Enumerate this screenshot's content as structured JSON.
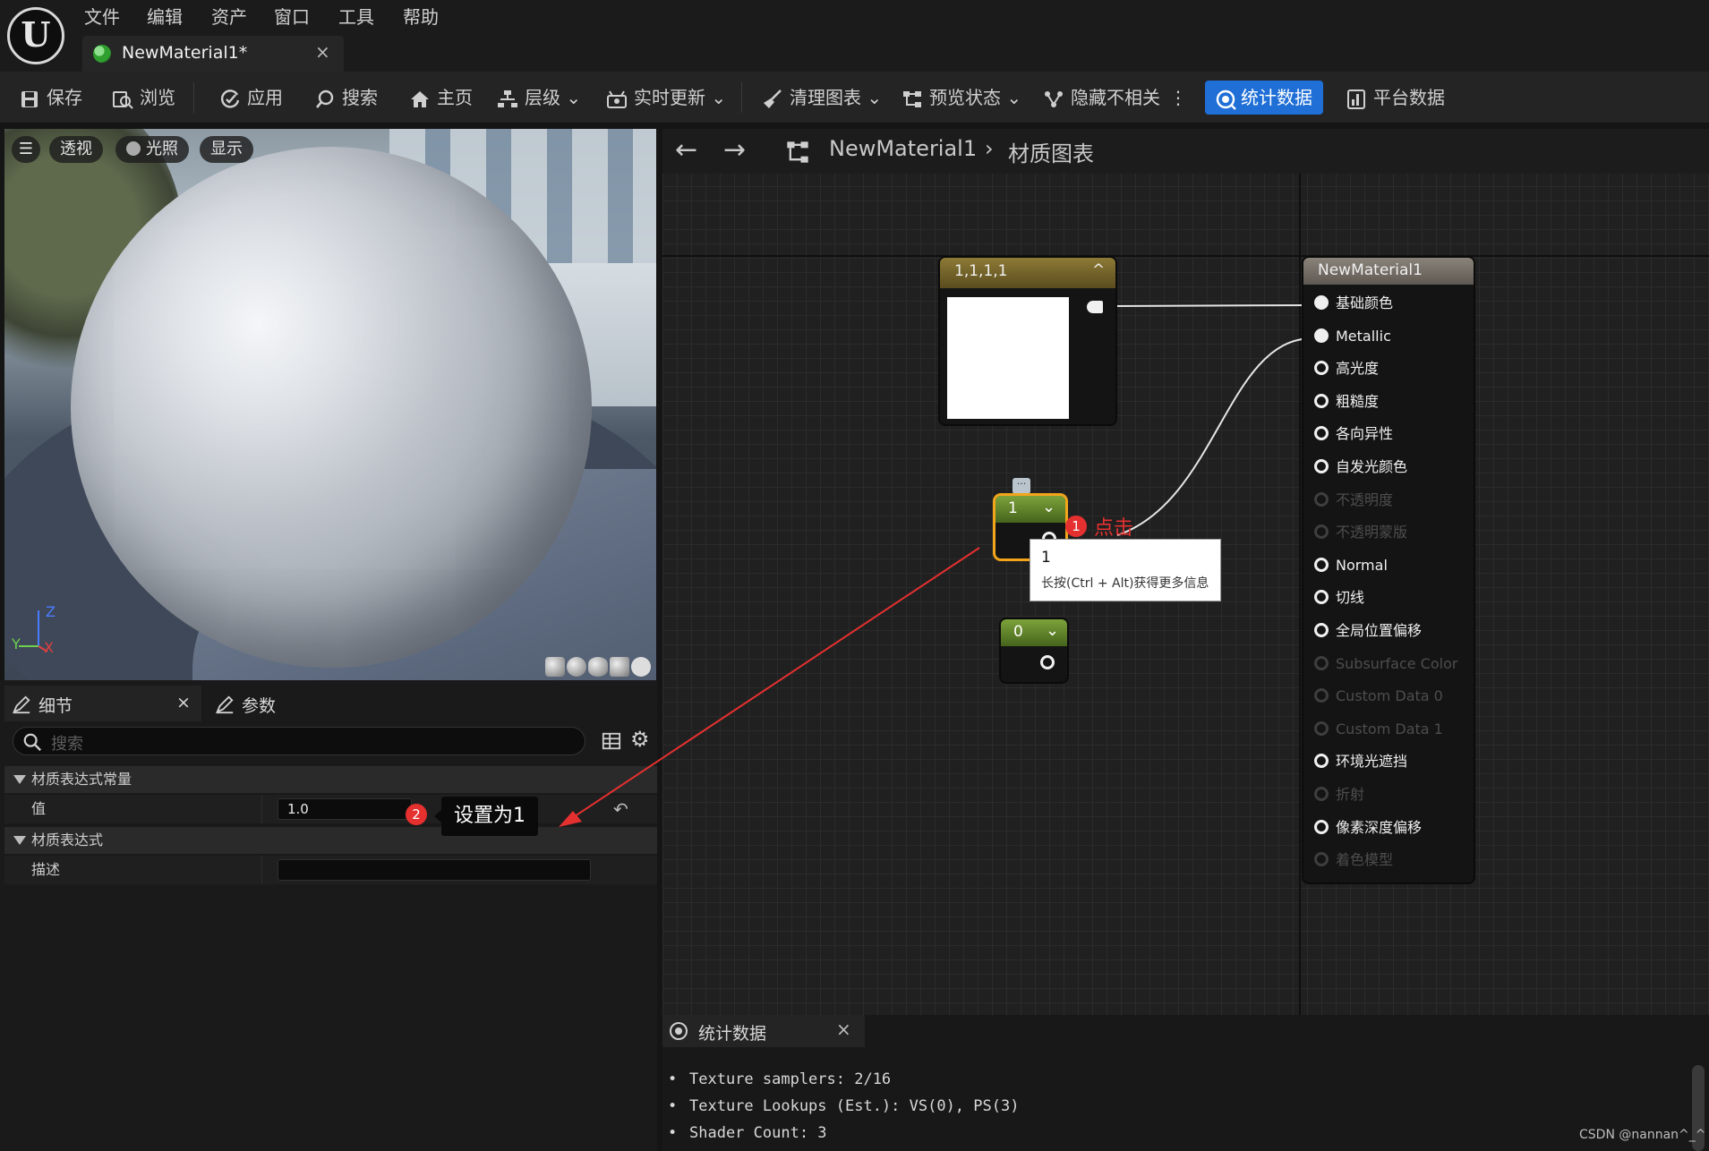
{
  "app": {
    "logo": "U"
  },
  "menu": [
    "文件",
    "编辑",
    "资产",
    "窗口",
    "工具",
    "帮助"
  ],
  "doc_tab": {
    "label": "NewMaterial1*",
    "close": "×"
  },
  "toolbar": {
    "save": "保存",
    "browse": "浏览",
    "apply": "应用",
    "search": "搜索",
    "home": "主页",
    "hierarchy": "层级",
    "live_update": "实时更新",
    "clean_graph": "清理图表",
    "preview_state": "预览状态",
    "hide_unrelated": "隐藏不相关",
    "more": "⋮",
    "stats": "统计数据",
    "platform_stats": "平台数据",
    "chevron": "⌄"
  },
  "viewport": {
    "perspective": "透视",
    "lit": "光照",
    "show": "显示",
    "axis": {
      "z": "Z",
      "y": "Y",
      "x": "X"
    }
  },
  "details": {
    "tab_details": "细节",
    "tab_params": "参数",
    "close": "×",
    "search_placeholder": "搜索",
    "section_constant": "材质表达式常量",
    "value_label": "值",
    "value": "1.0",
    "section_expression": "材质表达式",
    "desc_label": "描述",
    "desc_value": ""
  },
  "graph": {
    "breadcrumb_root": "NewMaterial1",
    "breadcrumb_sep": "›",
    "breadcrumb_leaf": "材质图表",
    "vector_node_title": "1,1,1,1",
    "vector_node_collapse": "^",
    "const1_value": "1",
    "const0_value": "0",
    "const_chevron": "⌄",
    "comment_icon": "···",
    "material_node_title": "NewMaterial1",
    "material_inputs": [
      {
        "label": "基础颜色",
        "enabled": true,
        "connected": true
      },
      {
        "label": "Metallic",
        "enabled": true,
        "connected": true
      },
      {
        "label": "高光度",
        "enabled": true,
        "connected": false
      },
      {
        "label": "粗糙度",
        "enabled": true,
        "connected": false
      },
      {
        "label": "各向异性",
        "enabled": true,
        "connected": false
      },
      {
        "label": "自发光颜色",
        "enabled": true,
        "connected": false
      },
      {
        "label": "不透明度",
        "enabled": false,
        "connected": false
      },
      {
        "label": "不透明蒙版",
        "enabled": false,
        "connected": false
      },
      {
        "label": "Normal",
        "enabled": true,
        "connected": false
      },
      {
        "label": "切线",
        "enabled": true,
        "connected": false
      },
      {
        "label": "全局位置偏移",
        "enabled": true,
        "connected": false
      },
      {
        "label": "Subsurface Color",
        "enabled": false,
        "connected": false
      },
      {
        "label": "Custom Data 0",
        "enabled": false,
        "connected": false
      },
      {
        "label": "Custom Data 1",
        "enabled": false,
        "connected": false
      },
      {
        "label": "环境光遮挡",
        "enabled": true,
        "connected": false
      },
      {
        "label": "折射",
        "enabled": false,
        "connected": false
      },
      {
        "label": "像素深度偏移",
        "enabled": true,
        "connected": false
      },
      {
        "label": "着色模型",
        "enabled": false,
        "connected": false
      }
    ],
    "tooltip_title": "1",
    "tooltip_hint": "长按(Ctrl + Alt)获得更多信息"
  },
  "annotations": {
    "step1_number": "1",
    "step1_text": "点击",
    "step2_number": "2",
    "step2_text": "设置为1",
    "color": "#e53030"
  },
  "stats": {
    "tab_label": "统计数据",
    "close": "×",
    "lines": [
      "Texture samplers: 2/16",
      "Texture Lookups (Est.): VS(0), PS(3)",
      "Shader Count: 3"
    ]
  },
  "watermark": "CSDN @nannan^_^"
}
